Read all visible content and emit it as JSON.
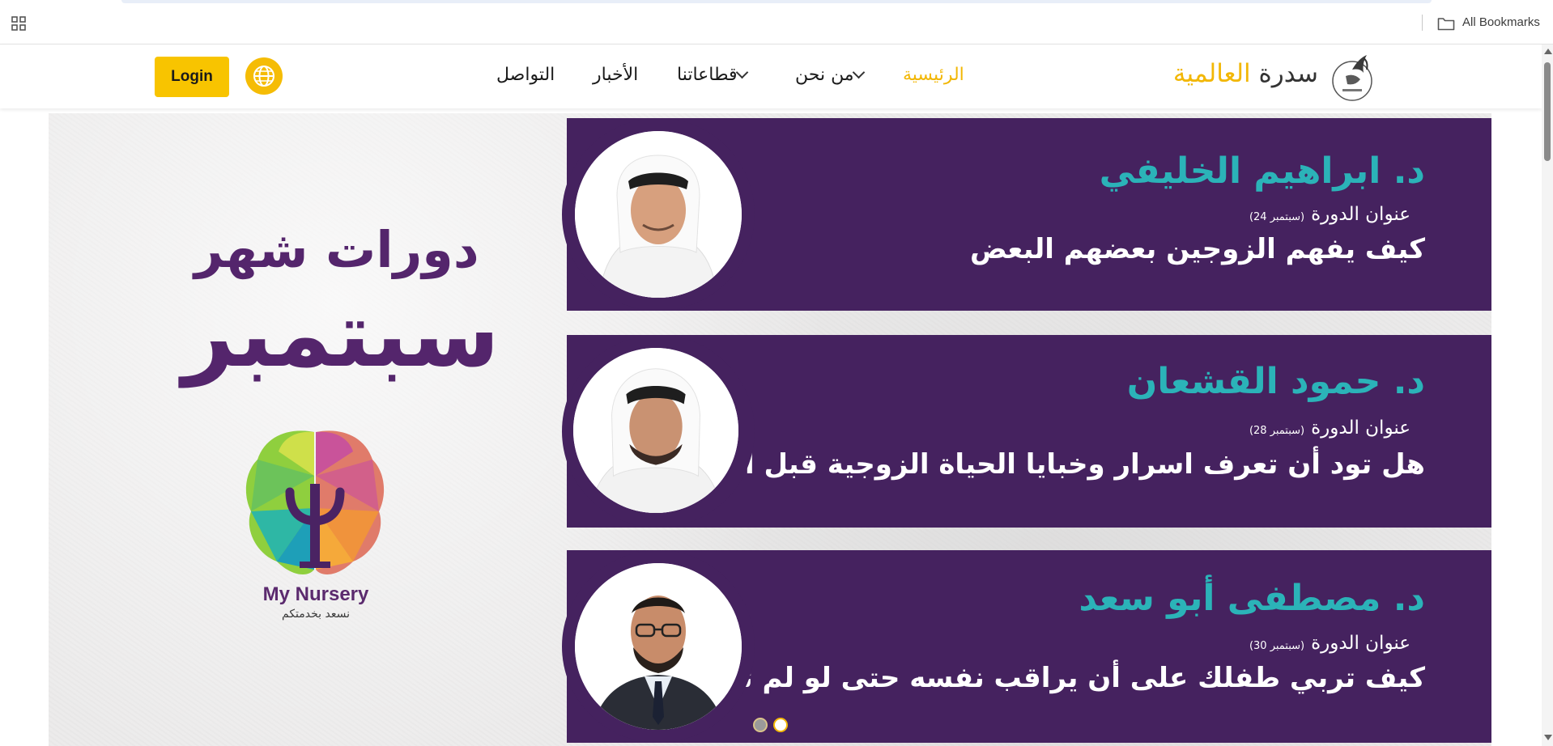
{
  "bookmarks_bar": {
    "label": "All Bookmarks",
    "apps_icon": "apps-grid-icon",
    "folder_icon": "folder-icon"
  },
  "header": {
    "logo_word_1": "سدرة",
    "logo_word_2": "العالمية",
    "nav": [
      {
        "label": "الرئيسية",
        "active": true
      },
      {
        "label": "من نحن",
        "dropdown": true
      },
      {
        "label": "قطاعاتنا",
        "dropdown": true
      },
      {
        "label": "الأخبار"
      },
      {
        "label": "التواصل"
      }
    ],
    "language_icon": "globe-icon",
    "login_label": "Login"
  },
  "colors": {
    "accent": "#f2b705",
    "banner_purple": "#45225f",
    "speaker_teal": "#2bb3b8",
    "title_purple": "#54256c"
  },
  "hero": {
    "promo_line_1": "دورات شهر",
    "promo_line_2": "سبتمبر",
    "brand_name": "My Nursery",
    "brand_tagline": "نسعد بخدمتكم",
    "courses": [
      {
        "speaker": "د. ابراهيم الخليفي",
        "label": "عنوان الدورة",
        "date": "(سبتمبر 24)",
        "title": "كيف يفهم الزوجين  بعضهم البعض"
      },
      {
        "speaker": "د. حمود القشعان",
        "label": "عنوان الدورة",
        "date": "(سبتمبر 28)",
        "title": "هل تود أن تعرف اسرار وخبايا الحياة الزوجية قبل الزواج"
      },
      {
        "speaker": "د. مصطفى أبو سعد",
        "label": "عنوان الدورة",
        "date": "(سبتمبر 30)",
        "title": "كيف تربي طفلك على أن يراقب نفسه حتى لو لم تكن بجانبه"
      }
    ],
    "slider": {
      "slide_count": 2,
      "active_index": 1
    }
  }
}
